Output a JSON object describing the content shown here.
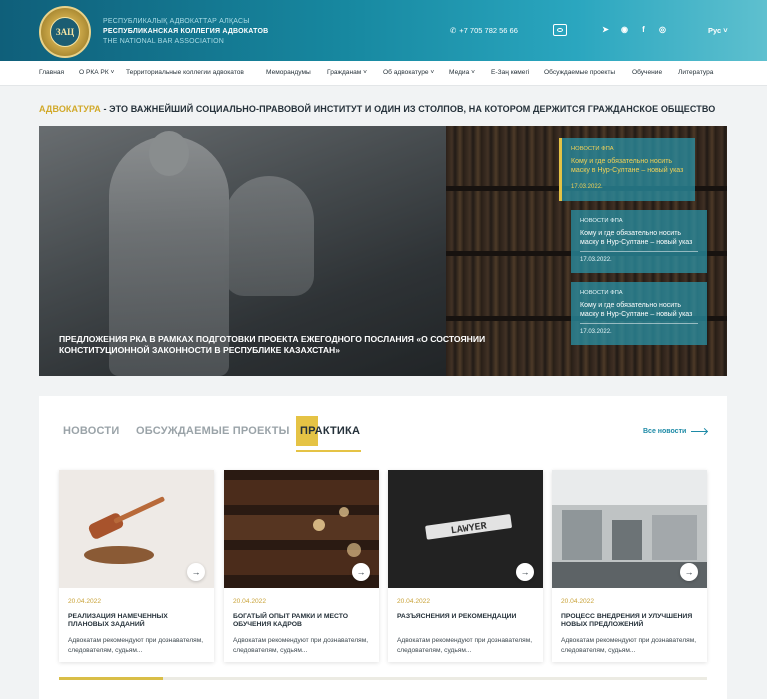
{
  "header": {
    "org_line1": "РЕСПУБЛИКАЛЫҚ АДВОКАТТАР АЛҚАСЫ",
    "org_line2": "РЕСПУБЛИКАНСКАЯ КОЛЛЕГИЯ АДВОКАТОВ",
    "org_line3": "THE NATIONAL BAR ASSOCIATION",
    "phone": "+7 705 782 56 66",
    "lang": "Рус",
    "socials": [
      "telegram-icon",
      "whatsapp-icon",
      "facebook-icon",
      "instagram-icon"
    ]
  },
  "nav": {
    "items": [
      "Главная",
      "О РКА РК",
      "Территориальные коллегии адвокатов",
      "Меморандумы",
      "Гражданам",
      "Об адвокатуре",
      "Медиа",
      "E-Заң көмегі",
      "Обсуждаемые проекты",
      "Обучение",
      "Литература"
    ]
  },
  "tagline": {
    "accent": "АДВОКАТУРА",
    "rest": " - ЭТО ВАЖНЕЙШИЙ СОЦИАЛЬНО-ПРАВОВОЙ ИНСТИТУТ И ОДИН ИЗ СТОЛПОВ, НА КОТОРОМ ДЕРЖИТСЯ ГРАЖДАНСКОЕ ОБЩЕСТВО"
  },
  "hero": {
    "title": "ПРЕДЛОЖЕНИЯ РКА В РАМКАХ ПОДГОТОВКИ ПРОЕКТА ЕЖЕГОДНОГО ПОСЛАНИЯ «О СОСТОЯНИИ КОНСТИТУЦИОННОЙ ЗАКОННОСТИ В РЕСПУБЛИКЕ КАЗАХСТАН»",
    "news": [
      {
        "category": "НОВОСТИ ФПА",
        "title": "Кому и где обязательно носить маску в Нур-Султане – новый указ",
        "date": "17.03.2022."
      },
      {
        "category": "НОВОСТИ ФПА",
        "title": "Кому и где обязательно носить маску в Нур-Султане – новый указ",
        "date": "17.03.2022."
      },
      {
        "category": "НОВОСТИ ФПА",
        "title": "Кому и где обязательно носить маску в Нур-Султане – новый указ",
        "date": "17.03.2022."
      }
    ]
  },
  "tabs": {
    "items": [
      "НОВОСТИ",
      "ОБСУЖДАЕМЫЕ ПРОЕКТЫ",
      "ПРАКТИКА"
    ],
    "active": "ПРАКТИКА",
    "all_news": "Все новости"
  },
  "cards": [
    {
      "date": "20.04.2022",
      "title": "РЕАЛИЗАЦИЯ НАМЕЧЕННЫХ ПЛАНОВЫХ ЗАДАНИЙ",
      "text": "Адвокатам рекомендуют при дознавателям, следователям, судьям..."
    },
    {
      "date": "20.04.2022",
      "title": "БОГАТЫЙ ОПЫТ РАМКИ И МЕСТО ОБУЧЕНИЯ КАДРОВ",
      "text": "Адвокатам рекомендуют при дознавателям, следователям, судьям..."
    },
    {
      "date": "20.04.2022",
      "title": "РАЗЪЯСНЕНИЯ И РЕКОМЕНДАЦИИ",
      "text": "Адвокатам рекомендуют при дознавателям, следователям, судьям...",
      "tile_text": "LAWYER"
    },
    {
      "date": "20.04.2022",
      "title": "ПРОЦЕСС ВНЕДРЕНИЯ И УЛУЧШЕНИЯ НОВЫХ ПРЕДЛОЖЕНИЙ",
      "text": "Адвокатам рекомендуют при дознавателям, следователям, судьям..."
    }
  ],
  "carousel_progress": 0.16,
  "colors": {
    "brand": "#1788a0",
    "accent": "#e5c345",
    "link": "#1d8aa6"
  }
}
